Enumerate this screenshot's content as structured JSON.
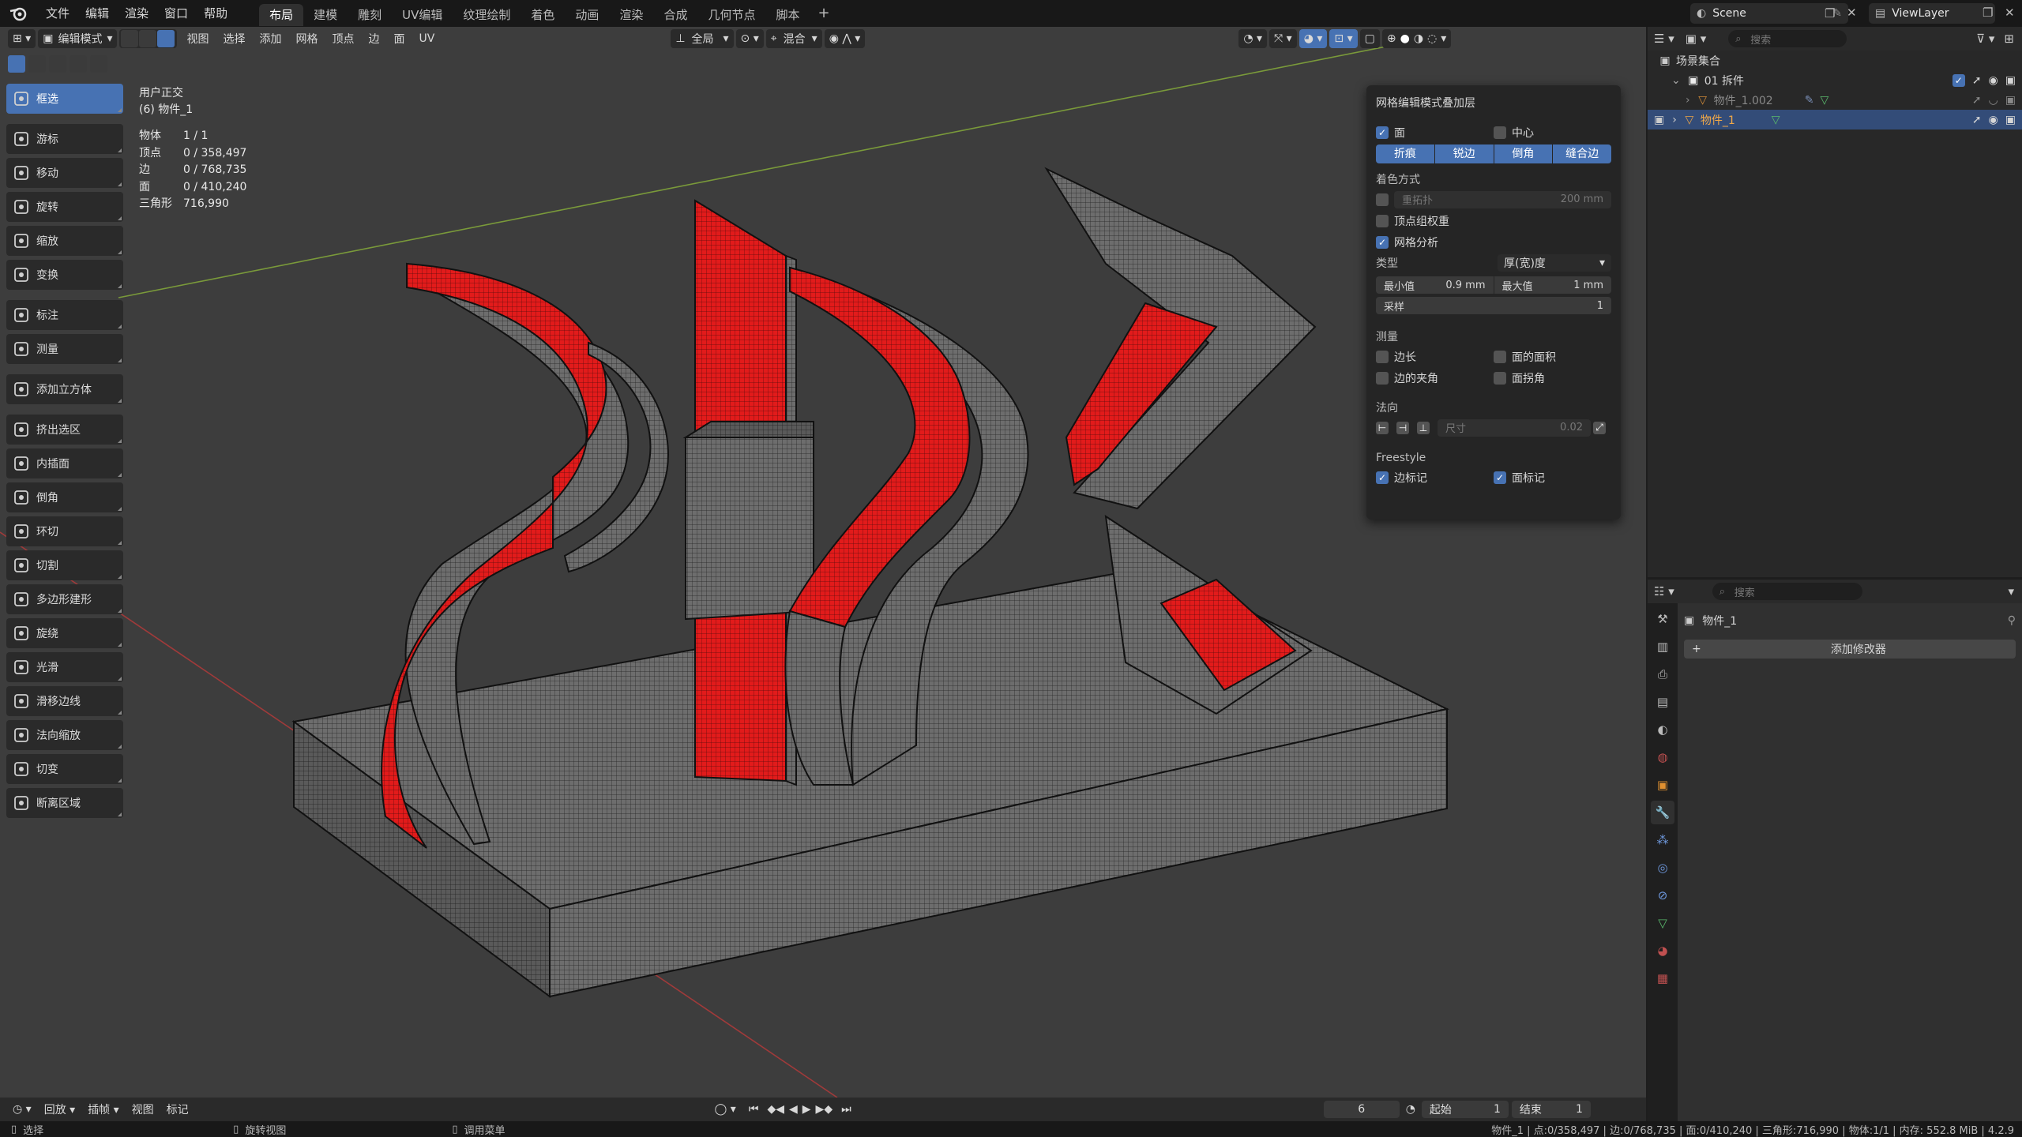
{
  "topbar": {
    "menus": [
      "文件",
      "编辑",
      "渲染",
      "窗口",
      "帮助"
    ],
    "workspaces": [
      "布局",
      "建模",
      "雕刻",
      "UV编辑",
      "纹理绘制",
      "着色",
      "动画",
      "渲染",
      "合成",
      "几何节点",
      "脚本"
    ],
    "active_workspace": "布局",
    "add_tab": "+",
    "scene_name": "Scene",
    "view_layer": "ViewLayer"
  },
  "viewport": {
    "mode": "编辑模式",
    "menus": [
      "视图",
      "选择",
      "添加",
      "网格",
      "顶点",
      "边",
      "面",
      "UV"
    ],
    "orientation": "全局",
    "snap_mode": "混合",
    "view_name": "用户正交",
    "object_label": "(6) 物件_1",
    "stats": [
      {
        "key": "物体",
        "value": "1 / 1"
      },
      {
        "key": "顶点",
        "value": "0 / 358,497"
      },
      {
        "key": "边",
        "value": "0 / 768,735"
      },
      {
        "key": "面",
        "value": "0 / 410,240"
      },
      {
        "key": "三角形",
        "value": "716,990"
      }
    ]
  },
  "toolbar": {
    "tools": [
      {
        "label": "框选",
        "icon": "select-box-icon",
        "active": true
      },
      {
        "label": "游标",
        "icon": "cursor-icon"
      },
      {
        "label": "移动",
        "icon": "move-icon"
      },
      {
        "label": "旋转",
        "icon": "rotate-icon"
      },
      {
        "label": "缩放",
        "icon": "scale-icon"
      },
      {
        "label": "变换",
        "icon": "transform-icon"
      },
      {
        "label": "标注",
        "icon": "annotate-icon"
      },
      {
        "label": "测量",
        "icon": "measure-icon"
      },
      {
        "label": "添加立方体",
        "icon": "add-cube-icon"
      },
      {
        "label": "挤出选区",
        "icon": "extrude-icon"
      },
      {
        "label": "内插面",
        "icon": "inset-icon"
      },
      {
        "label": "倒角",
        "icon": "bevel-icon"
      },
      {
        "label": "环切",
        "icon": "loop-cut-icon"
      },
      {
        "label": "切割",
        "icon": "knife-icon"
      },
      {
        "label": "多边形建形",
        "icon": "poly-build-icon"
      },
      {
        "label": "旋绕",
        "icon": "spin-icon"
      },
      {
        "label": "光滑",
        "icon": "smooth-icon"
      },
      {
        "label": "滑移边线",
        "icon": "edge-slide-icon"
      },
      {
        "label": "法向缩放",
        "icon": "shrink-fatten-icon"
      },
      {
        "label": "切变",
        "icon": "shear-icon"
      },
      {
        "label": "断离区域",
        "icon": "rip-region-icon"
      }
    ]
  },
  "overlay_panel": {
    "title": "网格编辑模式叠加层",
    "faces_label": "面",
    "center_label": "中心",
    "edge_buttons": [
      "折痕",
      "锐边",
      "倒角",
      "缝合边"
    ],
    "shading_title": "着色方式",
    "retopology_label": "重拓扑",
    "retopology_value": "200 mm",
    "vertex_group_weights_label": "顶点组权重",
    "mesh_analysis_label": "网格分析",
    "type_label": "类型",
    "type_value": "厚(宽)度",
    "min_label": "最小值",
    "min_value": "0.9 mm",
    "max_label": "最大值",
    "max_value": "1 mm",
    "samples_label": "采样",
    "samples_value": "1",
    "measure_title": "测量",
    "edge_length_label": "边长",
    "face_area_label": "面的面积",
    "edge_angle_label": "边的夹角",
    "face_angle_label": "面拐角",
    "normals_title": "法向",
    "normal_size_label": "尺寸",
    "normal_size_value": "0.02",
    "freestyle_title": "Freestyle",
    "edge_marks_label": "边标记",
    "face_marks_label": "面标记"
  },
  "timeline": {
    "playback": "回放",
    "keying": "插帧",
    "view": "视图",
    "marker": "标记",
    "current_frame": "6",
    "start_label": "起始",
    "start_value": "1",
    "end_label": "结束",
    "end_value": "1"
  },
  "statusbar": {
    "select": "选择",
    "rotate_view": "旋转视图",
    "call_menu": "调用菜单",
    "stats": "物件_1 | 点:0/358,497 | 边:0/768,735 | 面:0/410,240 | 三角形:716,990 | 物体:1/1 | 内存: 552.8 MiB | 4.2.9"
  },
  "outliner": {
    "search_placeholder": "搜索",
    "scene_collection": "场景集合",
    "collection": "01 拆件",
    "object_1": "物件_1.002",
    "object_2": "物件_1"
  },
  "properties": {
    "search_placeholder": "搜索",
    "object_name": "物件_1",
    "add_modifier": "添加修改器"
  },
  "colors": {
    "accent": "#4772b3",
    "thickness_warning": "#e21b1b",
    "viewport_bg": "#3d3d3d",
    "mesh_grey": "#6f6f6f"
  }
}
